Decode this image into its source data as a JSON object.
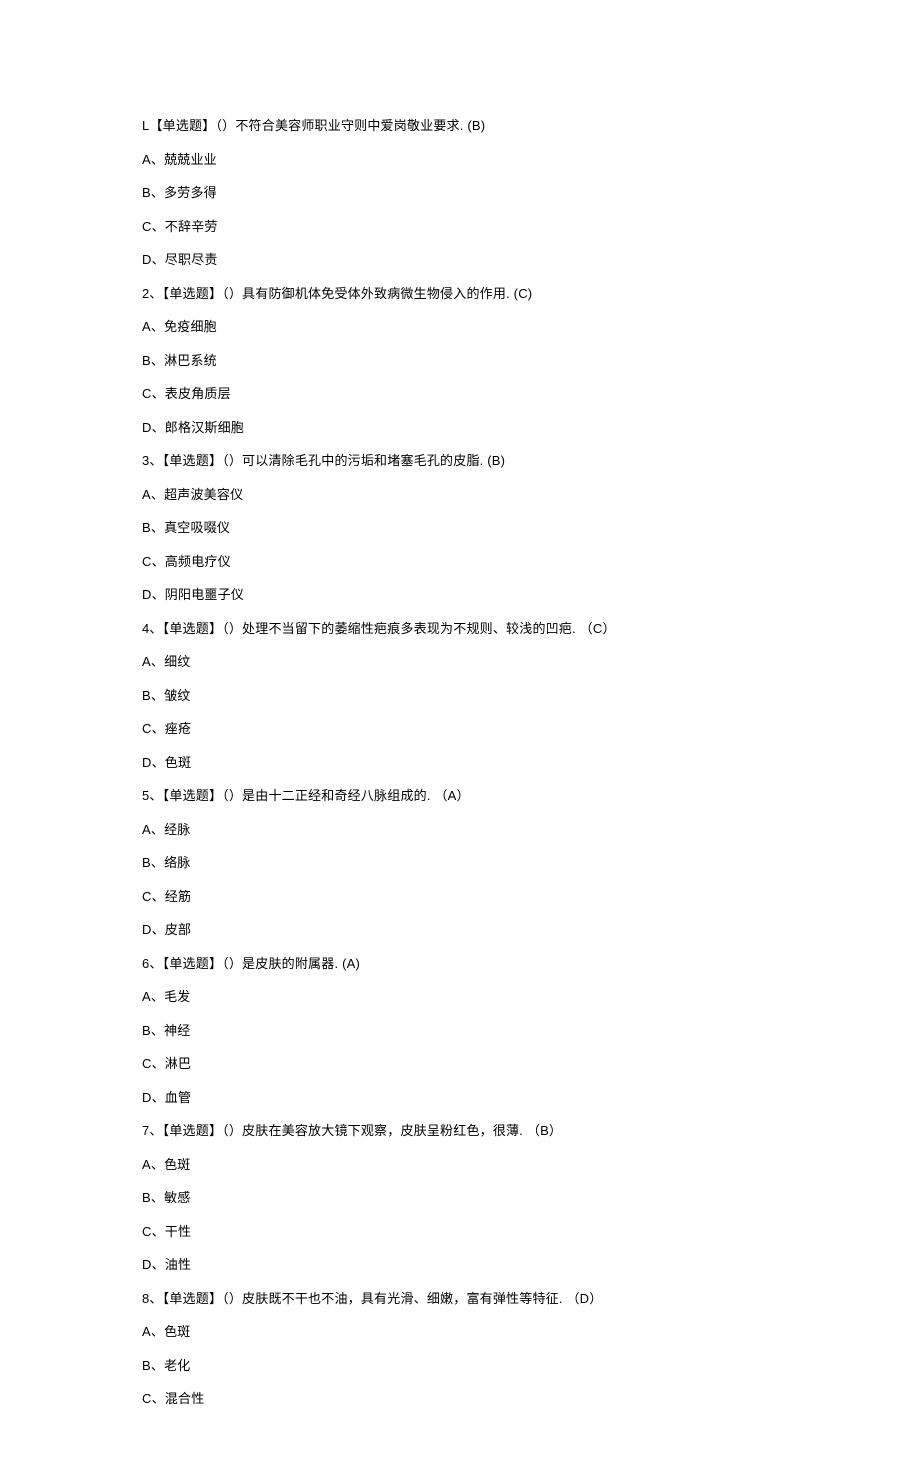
{
  "questions": [
    {
      "num": "L",
      "stem": "【单选题】（）不符合美容师职业守则中爱岗敬业要求.  (B)",
      "options": [
        {
          "letter": "A",
          "text": "兢兢业业"
        },
        {
          "letter": "B",
          "text": "多劳多得"
        },
        {
          "letter": "C",
          "text": "不辞辛劳"
        },
        {
          "letter": "D",
          "text": "尽职尽责"
        }
      ]
    },
    {
      "num": "2、",
      "stem": "【单选题】（）具有防御机体免受体外致病微生物侵入的作用.  (C)",
      "options": [
        {
          "letter": "A",
          "text": "免疫细胞"
        },
        {
          "letter": "B",
          "text": "淋巴系统"
        },
        {
          "letter": "C",
          "text": "表皮角质层"
        },
        {
          "letter": "D",
          "text": "郎格汉斯细胞"
        }
      ]
    },
    {
      "num": "3、",
      "stem": "【单选题】（）可以清除毛孔中的污垢和堵塞毛孔的皮脂.  (B)",
      "options": [
        {
          "letter": "A",
          "text": "超声波美容仪"
        },
        {
          "letter": "B",
          "text": "真空吸啜仪"
        },
        {
          "letter": "C",
          "text": "高频电疗仪"
        },
        {
          "letter": "D",
          "text": "阴阳电噩子仪"
        }
      ]
    },
    {
      "num": "4、",
      "stem": "【单选题】（）处理不当留下的萎缩性疤痕多表现为不规则、较浅的凹疤. （C）",
      "options": [
        {
          "letter": "A",
          "text": "细纹"
        },
        {
          "letter": "B",
          "text": "皱纹"
        },
        {
          "letter": "C",
          "text": "痤疮"
        },
        {
          "letter": "D",
          "text": "色斑"
        }
      ]
    },
    {
      "num": "5、",
      "stem": "【单选题】（）是由十二正经和奇经八脉组成的. （A）",
      "options": [
        {
          "letter": "A",
          "text": "经脉"
        },
        {
          "letter": "B",
          "text": "络脉"
        },
        {
          "letter": "C",
          "text": "经筋"
        },
        {
          "letter": "D",
          "text": "皮部"
        }
      ]
    },
    {
      "num": "6、",
      "stem": "【单选题】（）是皮肤的附属器.  (A)",
      "options": [
        {
          "letter": "A",
          "text": "毛发"
        },
        {
          "letter": "B",
          "text": "神经"
        },
        {
          "letter": "C",
          "text": "淋巴"
        },
        {
          "letter": "D",
          "text": "血管"
        }
      ]
    },
    {
      "num": "7、",
      "stem": "【单选题】（）皮肤在美容放大镜下观察，皮肤呈粉红色，很薄. （B）",
      "options": [
        {
          "letter": "A",
          "text": "色斑"
        },
        {
          "letter": "B",
          "text": "敏感"
        },
        {
          "letter": "C",
          "text": "干性"
        },
        {
          "letter": "D",
          "text": "油性"
        }
      ]
    },
    {
      "num": "8、",
      "stem": "【单选题】（）皮肤既不干也不油，具有光滑、细嫩，富有弹性等特征. （D）",
      "options": [
        {
          "letter": "A",
          "text": "色斑"
        },
        {
          "letter": "B",
          "text": "老化"
        },
        {
          "letter": "C",
          "text": "混合性"
        }
      ]
    }
  ]
}
